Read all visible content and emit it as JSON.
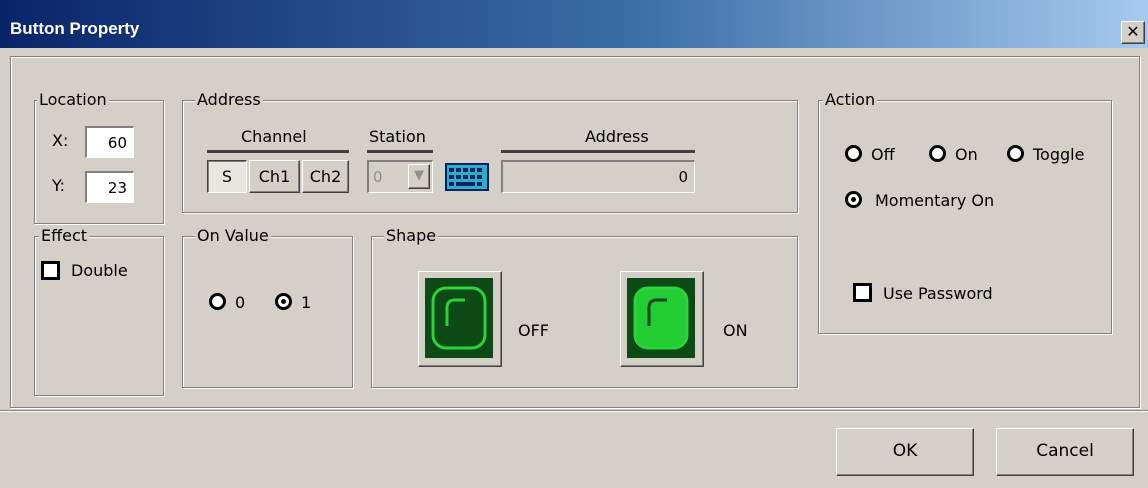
{
  "window": {
    "title": "Button Property",
    "close_glyph": "✕"
  },
  "location": {
    "legend": "Location",
    "x_label": "X:",
    "x_value": "60",
    "y_label": "Y:",
    "y_value": "23"
  },
  "address": {
    "legend": "Address",
    "channel_head": "Channel",
    "station_head": "Station",
    "address_head": "Address",
    "channel_buttons": [
      "S",
      "Ch1",
      "Ch2"
    ],
    "station_value": "0",
    "address_value": "0",
    "keypad_icon": "keypad-icon"
  },
  "effect": {
    "legend": "Effect",
    "double_label": "Double"
  },
  "on_value": {
    "legend": "On Value",
    "opt0": "0",
    "opt1": "1",
    "selected": "1"
  },
  "shape": {
    "legend": "Shape",
    "off_label": "OFF",
    "on_label": "ON",
    "colors": {
      "off_fill": "#0d4a16",
      "on_fill": "#22cc33"
    }
  },
  "action": {
    "legend": "Action",
    "off": "Off",
    "on": "On",
    "toggle": "Toggle",
    "momentary": "Momentary On",
    "selected": "Momentary On",
    "use_password": "Use Password"
  },
  "buttons": {
    "ok": "OK",
    "cancel": "Cancel"
  }
}
